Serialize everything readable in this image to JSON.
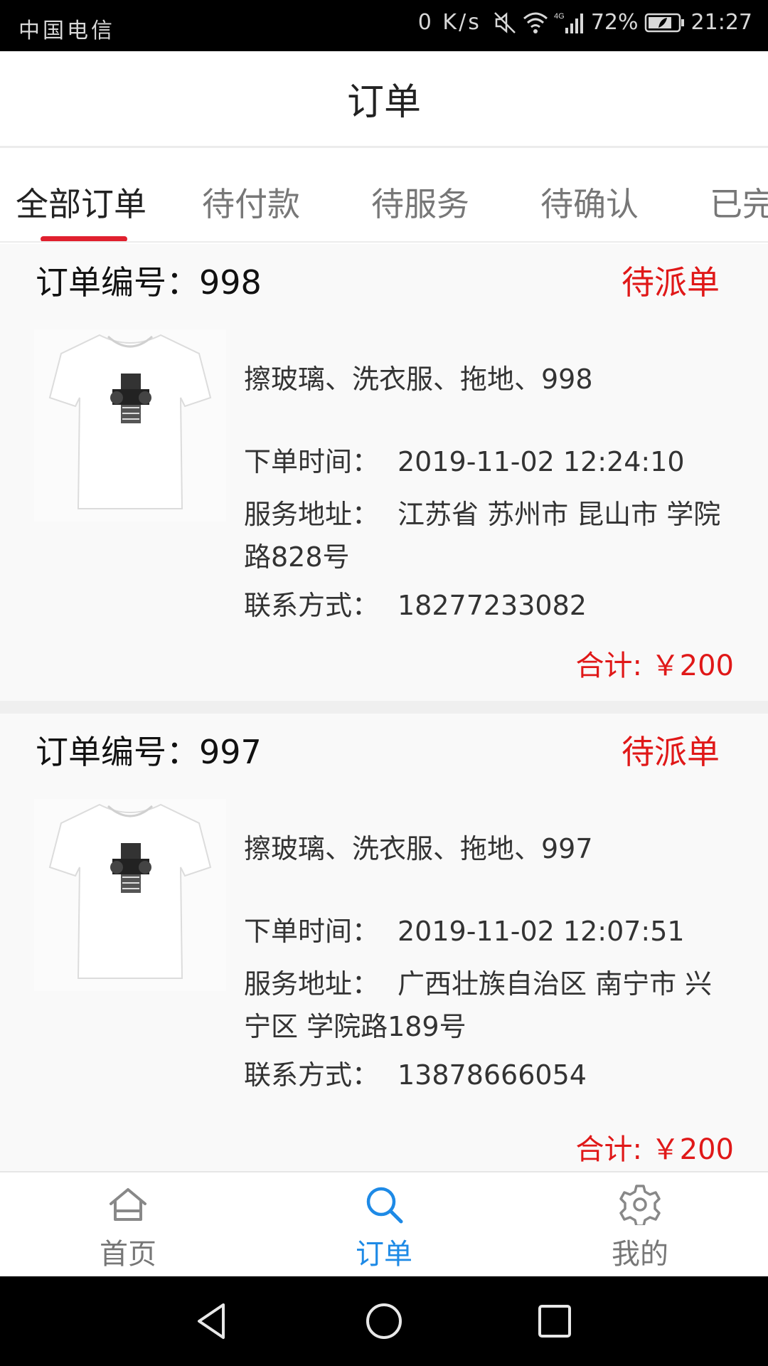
{
  "status_bar": {
    "carrier": "中国电信",
    "net_speed": "0 K/s",
    "network": "4G",
    "battery": "72%",
    "time": "21:27"
  },
  "title": "订单",
  "tabs": [
    {
      "label": "全部订单",
      "active": true
    },
    {
      "label": "待付款",
      "active": false
    },
    {
      "label": "待服务",
      "active": false
    },
    {
      "label": "待确认",
      "active": false
    },
    {
      "label": "已完",
      "active": false
    }
  ],
  "labels": {
    "time": "下单时间：",
    "address": "服务地址：",
    "phone": "联系方式："
  },
  "orders": [
    {
      "number": "订单编号：998",
      "status": "待派单",
      "services": "擦玻璃、洗衣服、拖地、998",
      "time": "2019-11-02 12:24:10",
      "address": "江苏省 苏州市 昆山市 学院路828号",
      "phone": "18277233082",
      "total": "合计: ￥200"
    },
    {
      "number": "订单编号：997",
      "status": "待派单",
      "services": "擦玻璃、洗衣服、拖地、997",
      "time": "2019-11-02 12:07:51",
      "address": "广西壮族自治区 南宁市 兴宁区 学院路189号",
      "phone": "13878666054",
      "total": "合计: ￥200"
    }
  ],
  "bottom_nav": [
    {
      "label": "首页",
      "icon": "home-icon",
      "active": false
    },
    {
      "label": "订单",
      "icon": "search-icon",
      "active": true
    },
    {
      "label": "我的",
      "icon": "gear-icon",
      "active": false
    }
  ],
  "colors": {
    "accent_red": "#e01818",
    "active_blue": "#1e8ae6",
    "indicator": "#e0202e"
  }
}
